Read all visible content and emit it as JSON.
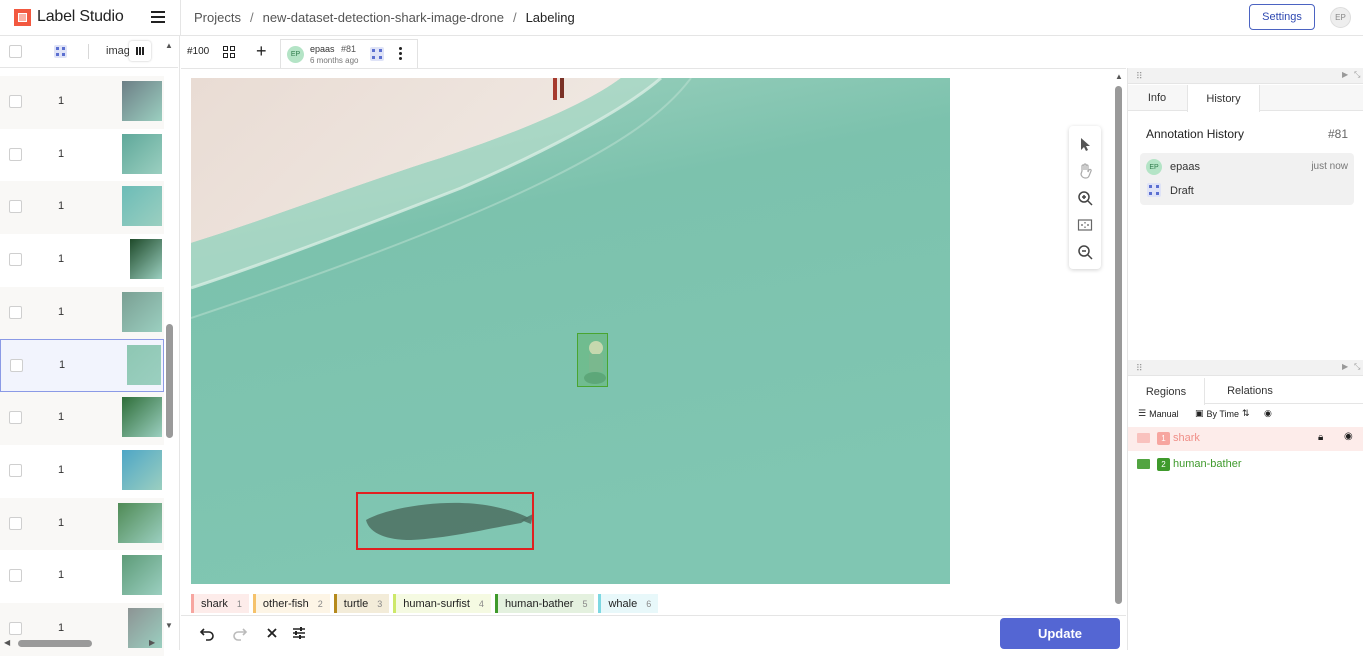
{
  "app": {
    "name": "Label Studio",
    "user_initials": "EP"
  },
  "breadcrumbs": [
    "Projects",
    "new-dataset-detection-shark-image-drone",
    "Labeling"
  ],
  "header": {
    "settings_label": "Settings"
  },
  "task_list": {
    "column_header_image": "imag",
    "rows": [
      {
        "value": "1",
        "thumb": "#6d7f86"
      },
      {
        "value": "1",
        "thumb": "#5fa89a"
      },
      {
        "value": "1",
        "thumb": "#6cbcb7"
      },
      {
        "value": "1",
        "thumb": "#1f4a2a"
      },
      {
        "value": "1",
        "thumb": "#7a9f93"
      },
      {
        "value": "1",
        "thumb": "#8ec7b3",
        "selected": true
      },
      {
        "value": "1",
        "thumb": "#2f6e39"
      },
      {
        "value": "1",
        "thumb": "#4ea6c6"
      },
      {
        "value": "1",
        "thumb": "#4f8a55"
      },
      {
        "value": "1",
        "thumb": "#5d9b78"
      },
      {
        "value": "1",
        "thumb": "#8d9494"
      }
    ]
  },
  "annotation": {
    "task_id": "#100",
    "user": "epaas",
    "annotation_id": "#81",
    "time": "6 months ago"
  },
  "labels": [
    {
      "name": "shark",
      "hotkey": "1",
      "color": "#f7a6a0",
      "bg": "#fdecea"
    },
    {
      "name": "other-fish",
      "hotkey": "2",
      "color": "#f5c26b",
      "bg": "#fdf5e6"
    },
    {
      "name": "turtle",
      "hotkey": "3",
      "color": "#b58a1e",
      "bg": "#f3ecd9"
    },
    {
      "name": "human-surfist",
      "hotkey": "4",
      "color": "#cde86a",
      "bg": "#f5fae2"
    },
    {
      "name": "human-bather",
      "hotkey": "5",
      "color": "#3f9a2c",
      "bg": "#e4f1df"
    },
    {
      "name": "whale",
      "hotkey": "6",
      "color": "#7ed8e2",
      "bg": "#e8f8fa"
    }
  ],
  "actions": {
    "update_label": "Update"
  },
  "side_panel": {
    "tabs_top": [
      "Info",
      "History"
    ],
    "history_title": "Annotation History",
    "history_id": "#81",
    "history_user": "epaas",
    "history_time": "just now",
    "history_status": "Draft",
    "tabs_bottom": [
      "Regions",
      "Relations"
    ],
    "sort_manual": "Manual",
    "sort_by_time": "By Time",
    "regions": [
      {
        "index": "1",
        "label": "shark",
        "color": "#f7a6a0",
        "text_color": "#f08f88",
        "highlighted": true
      },
      {
        "index": "2",
        "label": "human-bather",
        "color": "#3f9a2c",
        "text_color": "#3f9a2c",
        "highlighted": false
      }
    ]
  },
  "colors": {
    "accent": "#5466d3",
    "shark_box": "#e02020",
    "bather_box": "#49a530"
  }
}
